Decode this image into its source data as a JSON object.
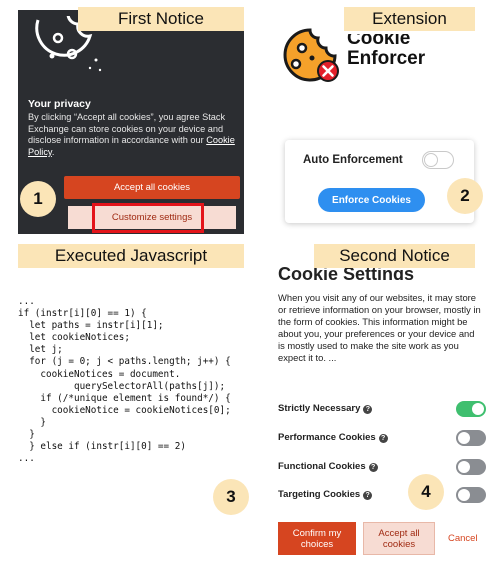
{
  "labels": {
    "first_notice": "First Notice",
    "extension": "Extension",
    "executed_js": "Executed Javascript",
    "second_notice": "Second Notice"
  },
  "badges": {
    "one": "1",
    "two": "2",
    "three": "3",
    "four": "4"
  },
  "colors": {
    "label_bg": "#fbe5b7",
    "accent_red": "#d64520",
    "highlight_red": "#e3141a",
    "button_blue": "#2e8ff0",
    "toggle_green": "#3fbf6f",
    "dark_bg": "#2b2d31"
  },
  "first_notice": {
    "title": "Your privacy",
    "body": "By clicking “Accept all cookies”, you agree Stack Exchange can store cookies on your device and disclose information in accordance with our ",
    "policy_link": "Cookie Policy",
    "body_end": ".",
    "accept_button": "Accept all cookies",
    "customize_button": "Customize settings"
  },
  "extension": {
    "logo_line1": "Cookie",
    "logo_line2": "Enforcer",
    "auto_enforcement_label": "Auto Enforcement",
    "auto_enforcement_on": false,
    "enforce_button": "Enforce Cookies",
    "icon": "cookie-icon"
  },
  "code": {
    "lines": [
      "...",
      "if (instr[i][0] == 1) {",
      "  let paths = instr[i][1];",
      "  let cookieNotices;",
      "  let j;",
      "  for (j = 0; j < paths.length; j++) {",
      "    cookieNotices = document.",
      "          querySelectorAll(paths[j]);",
      "    if (/*unique element is found*/) {",
      "      cookieNotice = cookieNotices[0];",
      "    }",
      "  }",
      "  } else if (instr[i][0] == 2)",
      "..."
    ]
  },
  "second_notice": {
    "title": "Cookie Settings",
    "body": "When you visit any of our websites, it may store or retrieve information on your browser, mostly in the form of cookies. This information might be about you, your preferences or your device and is mostly used to make the site work as you expect it to. ...",
    "categories": [
      {
        "label": "Strictly Necessary",
        "enabled": true
      },
      {
        "label": "Performance Cookies",
        "enabled": false
      },
      {
        "label": "Functional Cookies",
        "enabled": false
      },
      {
        "label": "Targeting Cookies",
        "enabled": false
      }
    ],
    "confirm_button": "Confirm my choices",
    "accept_button": "Accept all cookies",
    "cancel_link": "Cancel"
  }
}
